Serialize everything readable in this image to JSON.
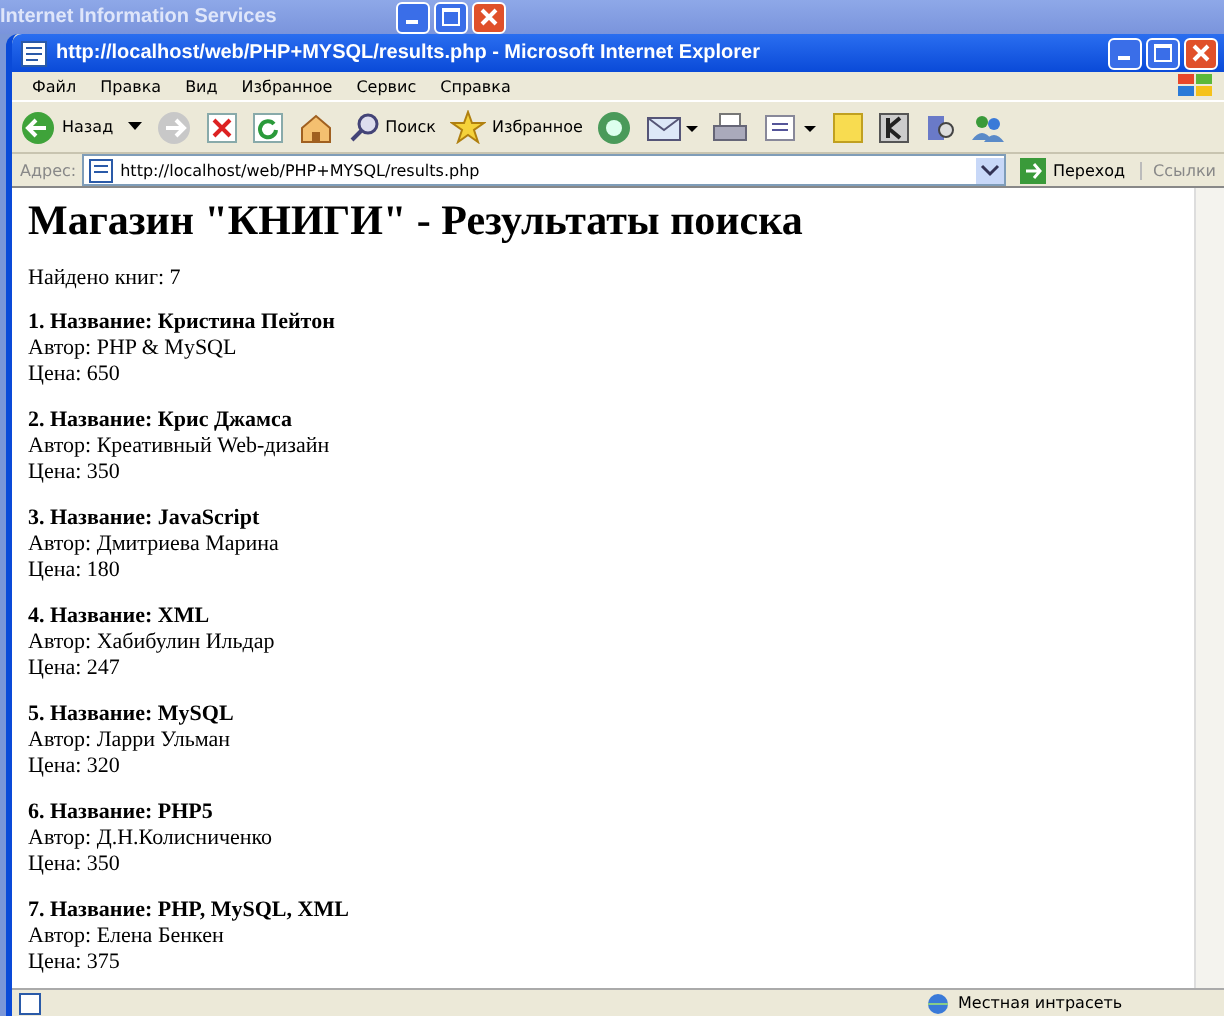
{
  "background_window": {
    "title": "Internet Information Services"
  },
  "window": {
    "title": "http://localhost/web/PHP+MYSQL/results.php - Microsoft Internet Explorer"
  },
  "menu": [
    "Файл",
    "Правка",
    "Вид",
    "Избранное",
    "Сервис",
    "Справка"
  ],
  "toolbar": {
    "back": "Назад",
    "search": "Поиск",
    "favorites": "Избранное"
  },
  "address_bar": {
    "label": "Адрес:",
    "url": "http://localhost/web/PHP+MYSQL/results.php",
    "go": "Переход",
    "links": "Ссылки"
  },
  "page": {
    "heading": "Магазин \"КНИГИ\" - Результаты поиска",
    "found": "Найдено книг: 7",
    "results": [
      {
        "title": "1. Название: Кристина Пейтон",
        "author": "Автор: PHP & MySQL",
        "price": "Цена: 650"
      },
      {
        "title": "2. Название: Крис Джамса",
        "author": "Автор: Креативный Web-дизайн",
        "price": "Цена: 350"
      },
      {
        "title": "3. Название: JavaScript",
        "author": "Автор: Дмитриева Марина",
        "price": "Цена: 180"
      },
      {
        "title": "4. Название: XML",
        "author": "Автор: Хабибулин Ильдар",
        "price": "Цена: 247"
      },
      {
        "title": "5. Название: MySQL",
        "author": "Автор: Ларри Ульман",
        "price": "Цена: 320"
      },
      {
        "title": "6. Название: PHP5",
        "author": "Автор: Д.Н.Колисниченко",
        "price": "Цена: 350"
      },
      {
        "title": "7. Название: PHP, MySQL, XML",
        "author": "Автор: Елена Бенкен",
        "price": "Цена: 375"
      }
    ]
  },
  "status_bar": {
    "zone": "Местная интрасеть"
  }
}
